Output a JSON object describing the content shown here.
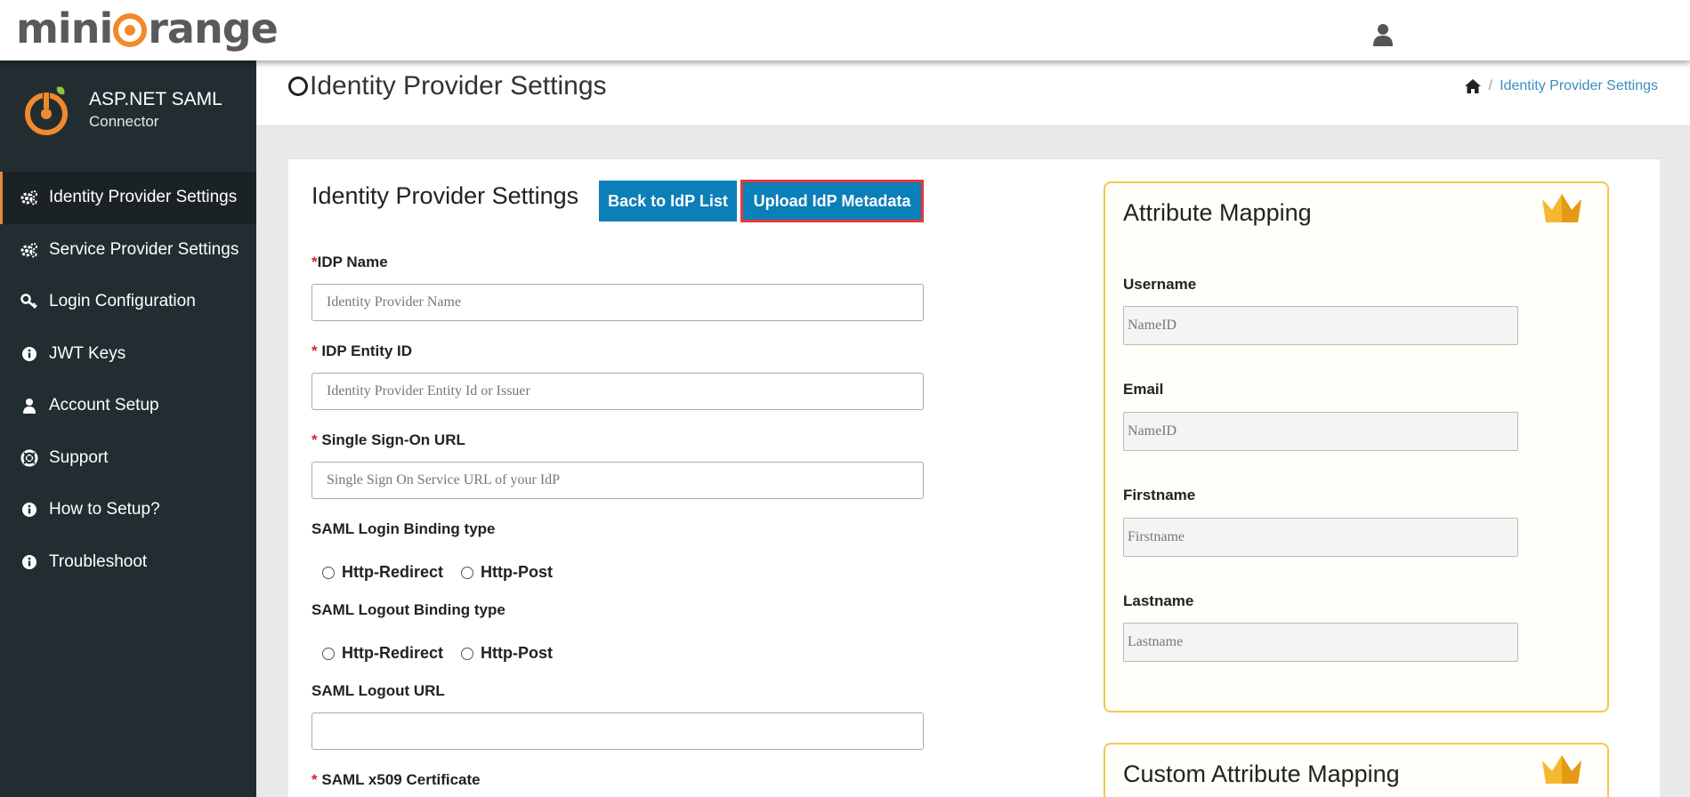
{
  "topbar": {
    "logo_left": "mini",
    "logo_right": "range",
    "user_icon": "user-icon"
  },
  "sidebar": {
    "brand_title": "ASP.NET SAML",
    "brand_sub": "Connector",
    "items": [
      {
        "label": "Identity Provider Settings",
        "icon": "gears-icon",
        "active": true
      },
      {
        "label": "Service Provider Settings",
        "icon": "gears-icon"
      },
      {
        "label": "Login Configuration",
        "icon": "key-icon"
      },
      {
        "label": "JWT Keys",
        "icon": "info-icon"
      },
      {
        "label": "Account Setup",
        "icon": "user-icon"
      },
      {
        "label": "Support",
        "icon": "lifebuoy-icon"
      },
      {
        "label": "How to Setup?",
        "icon": "info-icon"
      },
      {
        "label": "Troubleshoot",
        "icon": "info-icon"
      }
    ]
  },
  "header": {
    "title": "Identity Provider Settings",
    "breadcrumb": {
      "sep": "/",
      "current": "Identity Provider Settings"
    }
  },
  "form": {
    "title": "Identity Provider Settings",
    "back_button": "Back to IdP List",
    "upload_button": "Upload IdP Metadata",
    "required_mark": "*",
    "idp_name": {
      "label": "IDP Name",
      "placeholder": "Identity Provider Name",
      "value": ""
    },
    "idp_entity_id": {
      "label": "IDP Entity ID",
      "placeholder": "Identity Provider Entity Id or Issuer",
      "value": ""
    },
    "sso_url": {
      "label": "Single Sign-On URL",
      "placeholder": "Single Sign On Service URL of your IdP",
      "value": ""
    },
    "login_binding": {
      "label": "SAML Login Binding type",
      "options": [
        "Http-Redirect",
        "Http-Post"
      ]
    },
    "logout_binding": {
      "label": "SAML Logout Binding type",
      "options": [
        "Http-Redirect",
        "Http-Post"
      ]
    },
    "logout_url": {
      "label": "SAML Logout URL",
      "value": ""
    },
    "certificate": {
      "label": "SAML x509 Certificate"
    }
  },
  "attribute_mapping": {
    "title": "Attribute Mapping",
    "fields": [
      {
        "label": "Username",
        "placeholder": "NameID"
      },
      {
        "label": "Email",
        "placeholder": "NameID"
      },
      {
        "label": "Firstname",
        "placeholder": "Firstname"
      },
      {
        "label": "Lastname",
        "placeholder": "Lastname"
      }
    ]
  },
  "custom_attribute_mapping": {
    "title": "Custom Attribute Mapping"
  },
  "colors": {
    "accent_blue": "#0b7fb8",
    "highlight_red": "#e53935",
    "premium_gold": "#f2c94c",
    "sidebar_bg": "#222d32",
    "brand_orange": "#f08a2c"
  }
}
